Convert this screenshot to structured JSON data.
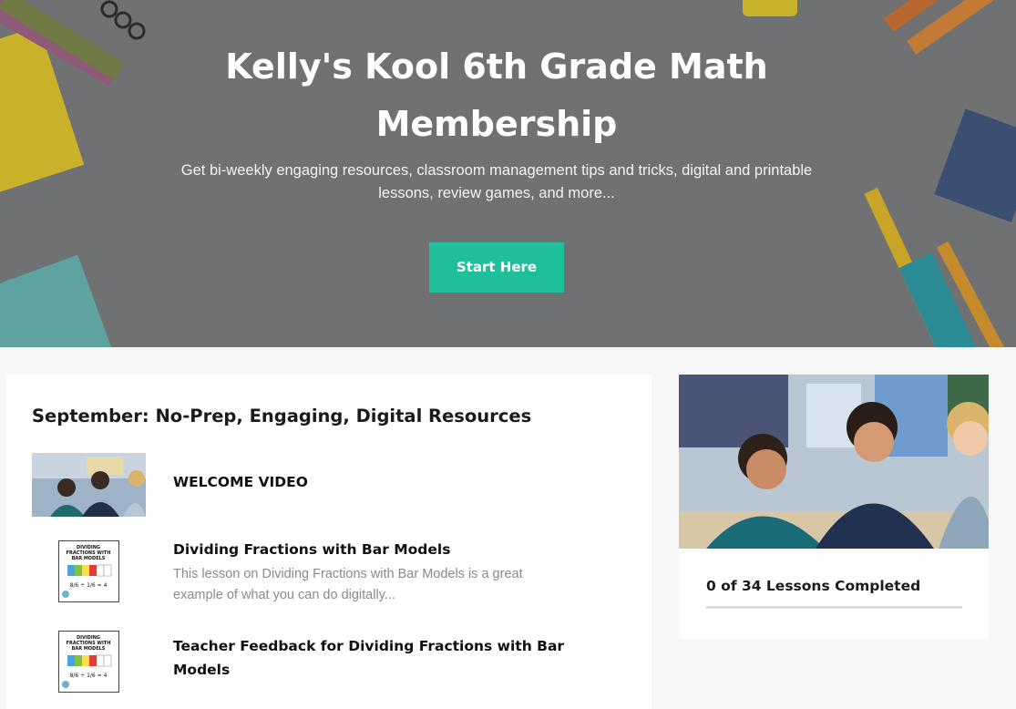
{
  "hero": {
    "title": "Kelly's Kool 6th Grade Math Membership",
    "subtitle": "Get bi-weekly engaging resources, classroom management tips and tricks, digital and printable lessons, review games, and more...",
    "cta_label": "Start Here"
  },
  "section": {
    "title": "September: No-Prep, Engaging, Digital Resources"
  },
  "lessons": [
    {
      "title": "WELCOME VIDEO",
      "description": ""
    },
    {
      "title": "Dividing Fractions with Bar Models",
      "description": "This lesson on Dividing Fractions with Bar Models is a great example of what you can do digitally..."
    },
    {
      "title": "Teacher Feedback for Dividing Fractions with Bar Models",
      "description": ""
    }
  ],
  "thumb_doc": {
    "heading": "DIVIDING FRACTIONS WITH BAR MODELS",
    "equation": "8/6 ÷ 1/6 = 4"
  },
  "progress": {
    "label": "0 of 34 Lessons Completed",
    "completed": 0,
    "total": 34
  },
  "colors": {
    "accent": "#1fbf9b",
    "hero_overlay": "#6d6e70"
  }
}
